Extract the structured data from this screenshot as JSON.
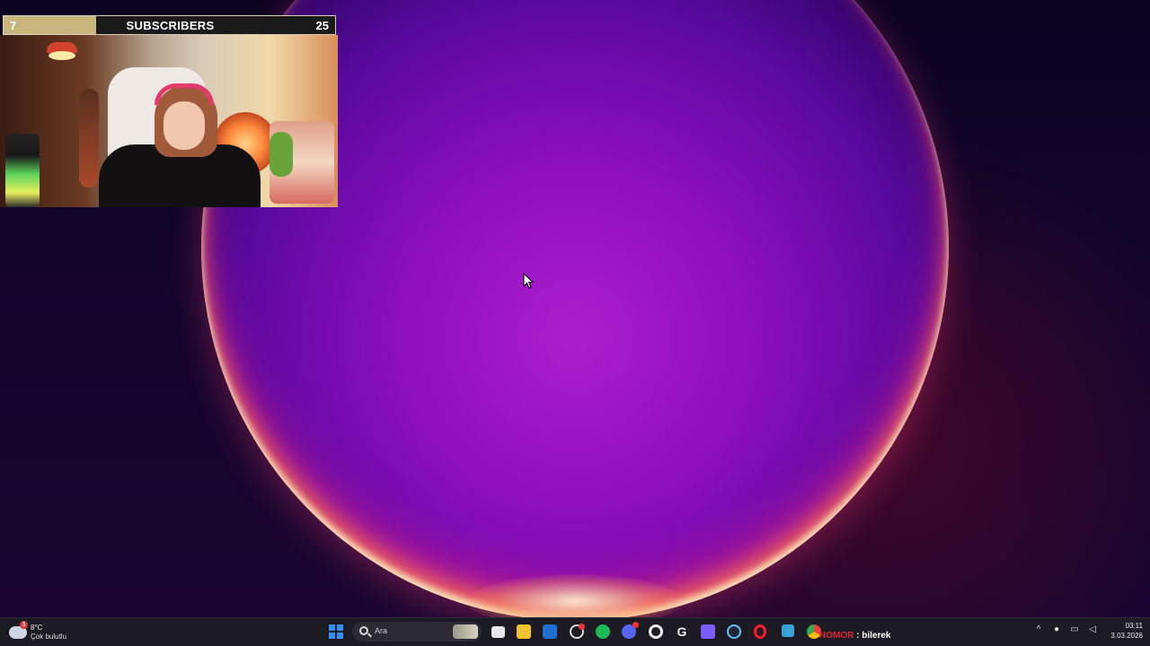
{
  "overlay": {
    "subscribers": {
      "current": "7",
      "label": "SUBSCRIBERS",
      "goal": "25",
      "progress_fraction": 0.28,
      "fill_color": "#c9b57e"
    }
  },
  "desktop": {
    "wallpaper_colors": [
      "#0b0322",
      "#b01fd0",
      "#ff3a78",
      "#ffe9c2"
    ]
  },
  "taskbar": {
    "weather": {
      "temperature": "8°C",
      "description": "Çok bulutlu",
      "badge": "3"
    },
    "search": {
      "placeholder": "Ara"
    },
    "pinned_icons": [
      "windows-start-icon",
      "task-view-icon",
      "file-explorer-icon",
      "outlook-icon",
      "chatgpt-icon",
      "spotify-icon",
      "discord-icon",
      "settings-icon",
      "g-app-icon",
      "grid-app-icon",
      "steam-icon",
      "opera-icon",
      "app-tray-icon",
      "chrome-icon"
    ],
    "notification": {
      "user": "NOMOR",
      "message": ": bilerek"
    },
    "clock": {
      "time": "03:11",
      "date": "3.03.2026"
    },
    "tray_icons": [
      "chevron-up-icon",
      "microphone-icon",
      "monitor-icon",
      "speaker-icon"
    ]
  }
}
